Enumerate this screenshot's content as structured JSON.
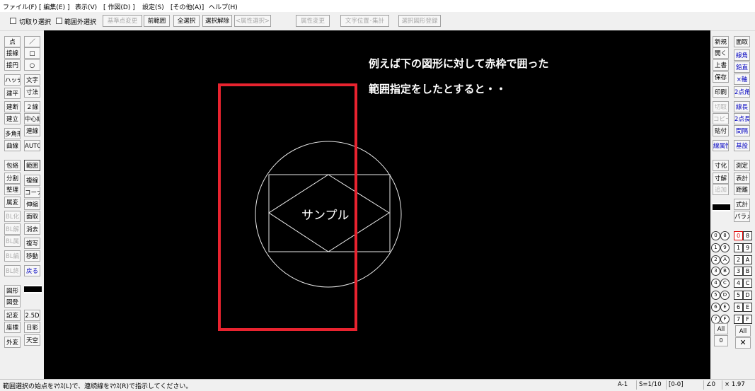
{
  "menu": [
    "ファイル(F)",
    "[ 編集(E) ]",
    "表示(V)",
    "[ 作図(D) ]",
    "設定(S)",
    "[その他(A)]",
    "ヘルプ(H)"
  ],
  "toolbar": {
    "cut_select": "切取り選択",
    "outside_select": "範囲外選択",
    "buttons": [
      "基準点変更",
      "前範囲",
      "全選択",
      "選択解除",
      "<属性選択>",
      "属性変更",
      "文字位置･集計",
      "選択図形登録"
    ]
  },
  "left_tools": [
    [
      "点",
      "／"
    ],
    [
      "接線",
      "□"
    ],
    [
      "接円",
      "○"
    ],
    [
      "ハッチ",
      "文字"
    ],
    [
      "建平",
      "寸法"
    ],
    [
      "建断",
      "２線"
    ],
    [
      "建立",
      "中心線"
    ],
    [
      "多角形",
      "連線"
    ],
    [
      "曲線",
      "AUTO"
    ],
    [
      "包絡",
      "範囲"
    ],
    [
      "分割",
      "複線"
    ],
    [
      "整理",
      "コーナー"
    ],
    [
      "属変",
      "伸縮"
    ],
    [
      "BL化",
      "面取"
    ],
    [
      "BL解",
      "消去"
    ],
    [
      "BL属",
      "複写"
    ],
    [
      "BL編",
      "移動"
    ],
    [
      "BL終",
      "戻る"
    ],
    [
      "図形",
      ""
    ],
    [
      "図登",
      ""
    ],
    [
      "記変",
      "2.5D"
    ],
    [
      "座標",
      "日影"
    ],
    [
      "外変",
      "天空"
    ]
  ],
  "right_tools": [
    [
      "新規",
      "面取"
    ],
    [
      "開く",
      "線角"
    ],
    [
      "上書",
      "鉛直"
    ],
    [
      "保存",
      "×軸"
    ],
    [
      "印刷",
      "2点角"
    ],
    [
      "切取",
      "線長"
    ],
    [
      "コピー",
      "2点長"
    ],
    [
      "貼付",
      "間隔"
    ],
    [
      "線属性",
      "基設"
    ],
    [
      "寸化",
      "測定"
    ],
    [
      "寸解",
      "表計"
    ],
    [
      "追加",
      "距離"
    ],
    [
      "",
      "式計"
    ],
    [
      "",
      "パラメ"
    ]
  ],
  "layer_groups": [
    "0",
    "1",
    "2",
    "3",
    "4",
    "5",
    "6",
    "7"
  ],
  "layer_group_alt": [
    "8",
    "9",
    "A",
    "B",
    "C",
    "D",
    "E",
    "F"
  ],
  "layers": [
    "0",
    "1",
    "2",
    "3",
    "4",
    "5",
    "6",
    "7"
  ],
  "layers_alt": [
    "8",
    "9",
    "A",
    "B",
    "C",
    "D",
    "E",
    "F"
  ],
  "layer_all": "All",
  "canvas": {
    "annotation_line1": "例えば下の図形に対して赤枠で囲った",
    "annotation_line2": "範囲指定をしたとすると・・",
    "sample_text": "サンプル"
  },
  "status": {
    "message": "範囲選択の始点をﾏｳｽ(L)で、連続線をﾏｳｽ(R)で指示してください。",
    "paper": "A-1",
    "scale": "S=1/10",
    "layer": "[0-0]",
    "angle": "∠0",
    "factor": "× 1.97"
  }
}
